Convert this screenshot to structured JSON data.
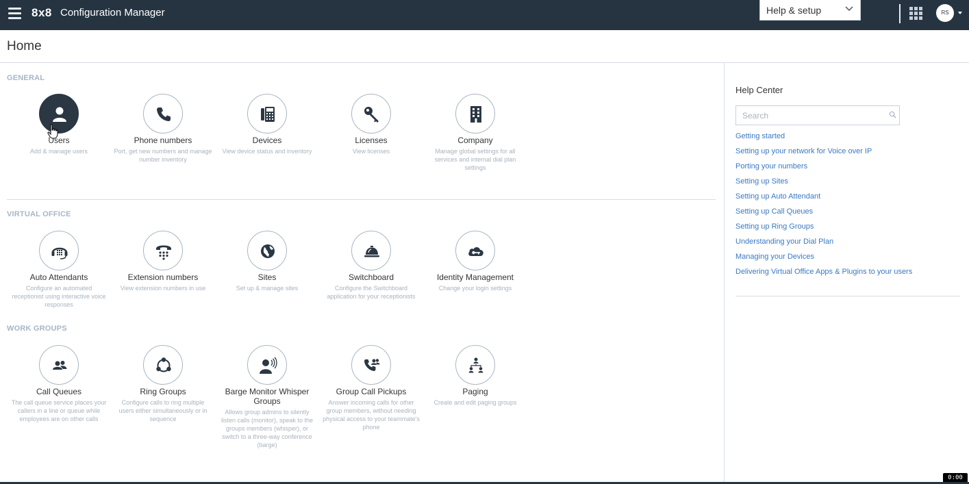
{
  "topbar": {
    "brand": "8x8",
    "app_title": "Configuration Manager",
    "help_select": "Help & setup",
    "avatar_initials": "RS",
    "icons": [
      "menu-icon",
      "chevron-down-icon",
      "apps-grid-icon",
      "caret-down-icon"
    ]
  },
  "page": {
    "title": "Home"
  },
  "sections": {
    "general": {
      "title": "GENERAL",
      "tiles": [
        {
          "label": "Users",
          "desc": "Add & manage users",
          "icon": "user-icon"
        },
        {
          "label": "Phone numbers",
          "desc": "Port, get new numbers and manage number inventory",
          "icon": "phone-icon"
        },
        {
          "label": "Devices",
          "desc": "View device status and inventory",
          "icon": "desk-phone-icon"
        },
        {
          "label": "Licenses",
          "desc": "View licenses",
          "icon": "key-icon"
        },
        {
          "label": "Company",
          "desc": "Manage global settings for all services and internal dial plan settings",
          "icon": "building-icon"
        }
      ]
    },
    "virtual_office": {
      "title": "VIRTUAL OFFICE",
      "tiles": [
        {
          "label": "Auto Attendants",
          "desc": "Configure an automated receptionist using interactive voice responses",
          "icon": "auto-attendant-icon"
        },
        {
          "label": "Extension numbers",
          "desc": "View extension numbers in use",
          "icon": "keypad-phone-icon"
        },
        {
          "label": "Sites",
          "desc": "Set up & manage sites",
          "icon": "globe-icon"
        },
        {
          "label": "Switchboard",
          "desc": "Configure the Switchboard application for your receptionists",
          "icon": "bell-icon"
        },
        {
          "label": "Identity Management",
          "desc": "Change your login settings",
          "icon": "cloud-key-icon"
        }
      ]
    },
    "work_groups": {
      "title": "WORK GROUPS",
      "tiles": [
        {
          "label": "Call Queues",
          "desc": "The call queue service places your callers in a line or queue while employees are on other calls",
          "icon": "people-icon"
        },
        {
          "label": "Ring Groups",
          "desc": "Configure calls to ring multiple users either simultaneously or in sequence",
          "icon": "ring-group-icon"
        },
        {
          "label": "Barge Monitor Whisper Groups",
          "desc": "Allows group admins to silently listen calls (monitor), speak to the groups members (whisper), or switch to a three-way conference (barge)",
          "icon": "speaking-user-icon"
        },
        {
          "label": "Group Call Pickups",
          "desc": "Answer incoming calls for other group members, without needing physical access to your teammate's phone",
          "icon": "group-call-icon"
        },
        {
          "label": "Paging",
          "desc": "Create and edit paging groups",
          "icon": "paging-icon"
        }
      ]
    }
  },
  "help_center": {
    "title": "Help Center",
    "search_placeholder": "Search",
    "links": [
      "Getting started",
      "Setting up your network for Voice over IP",
      "Porting your numbers",
      "Setting up Sites",
      "Setting up Auto Attendant",
      "Setting up Call Queues",
      "Setting up Ring Groups",
      "Understanding your Dial Plan",
      "Managing your Devices",
      "Delivering Virtual Office Apps & Plugins to your users"
    ]
  },
  "timer": "0:00",
  "colors": {
    "topbar": "#263442",
    "link": "#3a78c4",
    "section_title": "#a7b6c6",
    "icon": "#2b3743"
  }
}
